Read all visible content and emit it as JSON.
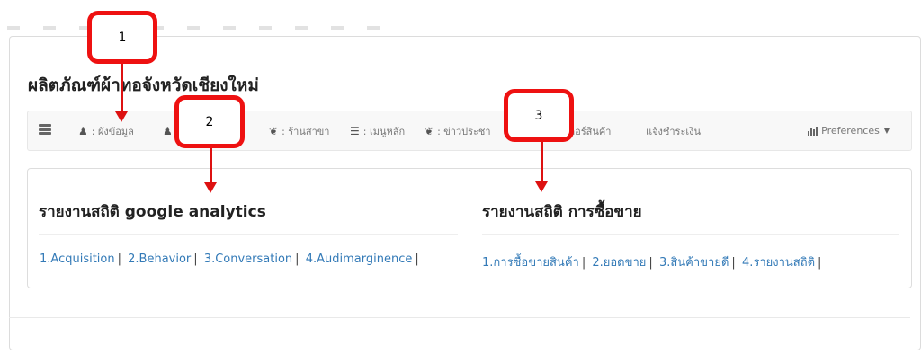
{
  "page": {
    "title": "ผลิตภัณฑ์ผ้าทอจังหวัดเชียงใหม่"
  },
  "navbar": {
    "items": [
      {
        "label": ": ผังข้อมูล",
        "icon": "user-icon"
      },
      {
        "label": ": ร้านสาขา",
        "icon": "leaf-icon"
      },
      {
        "label": ": เมนูหลัก",
        "icon": "list-icon"
      },
      {
        "label": ": ข่าวประชา",
        "icon": "leaf-icon"
      },
      {
        "label": "ดอร์สินค้า",
        "icon": ""
      },
      {
        "label": "แจ้งชำระเงิน",
        "icon": ""
      }
    ],
    "preferences_label": "Preferences"
  },
  "analytics": {
    "title": "รายงานสถิติ google analytics",
    "links": [
      "1.Acquisition",
      "2.Behavior",
      "3.Conversation",
      "4.Audimarginence"
    ]
  },
  "sales": {
    "title": "รายงานสถิติ การซื้อขาย",
    "links": [
      "1.การซื้อขายสินค้า",
      "2.ยอดขาย",
      "3.สินค้าขายดี",
      "4.รายงานสถิติ"
    ]
  },
  "annotations": {
    "callout_1": "1",
    "callout_2": "2",
    "callout_3": "3",
    "color": "#ee1111"
  },
  "colors": {
    "link": "#337ab7",
    "navbar_bg": "#f8f8f8"
  }
}
